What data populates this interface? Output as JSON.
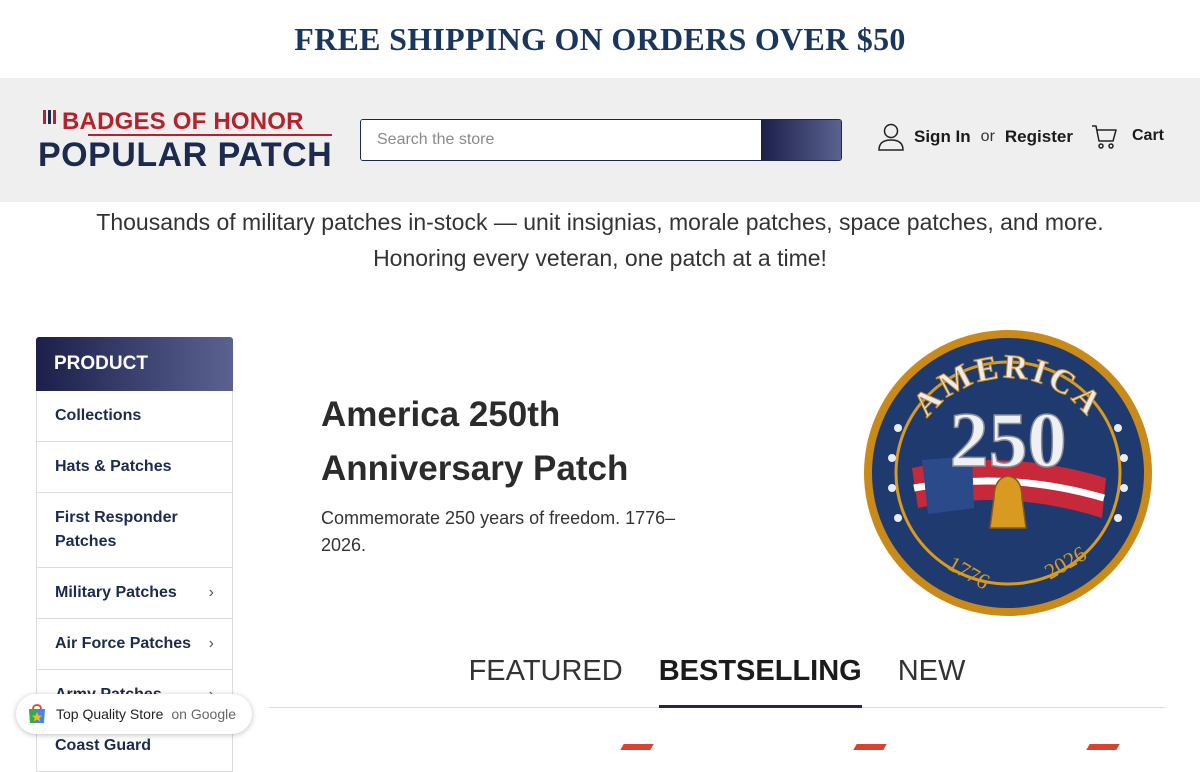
{
  "topbar": {
    "text": "FREE SHIPPING ON ORDERS OVER $50"
  },
  "logo": {
    "line1": "BADGES OF HONOR",
    "line2": "POPULAR PATCH"
  },
  "search": {
    "placeholder": "Search the store"
  },
  "account": {
    "sign_in": "Sign In",
    "or": "or",
    "register": "Register"
  },
  "cart": {
    "label": "Cart"
  },
  "tagline": {
    "line1": "Thousands of military patches in-stock — unit insignias, morale patches, space patches, and more.",
    "line2": "Honoring every veteran, one patch at a time!"
  },
  "sidebar": {
    "heading": "PRODUCT",
    "items": [
      {
        "label": "Collections",
        "has_children": false
      },
      {
        "label": "Hats & Patches",
        "has_children": false
      },
      {
        "label": "First Responder Patches",
        "has_children": false
      },
      {
        "label": "Military Patches",
        "has_children": true
      },
      {
        "label": "Air Force Patches",
        "has_children": true
      },
      {
        "label": "Army Patches",
        "has_children": true
      },
      {
        "label": "Coast Guard",
        "has_children": false
      }
    ]
  },
  "hero": {
    "title": "America 250th Anniversary Patch",
    "description": "Commemorate 250 years of freedom. 1776–2026.",
    "patch": {
      "top_text": "AMERICA",
      "number": "250",
      "year_left": "1776",
      "year_right": "2026"
    }
  },
  "tabs": [
    {
      "label": "FEATURED",
      "active": false
    },
    {
      "label": "BESTSELLING",
      "active": true
    },
    {
      "label": "NEW",
      "active": false
    }
  ],
  "google_badge": {
    "text": "Top Quality Store",
    "suffix": "on Google"
  },
  "colors": {
    "navy": "#1b2a4e",
    "brand_red": "#b5222c",
    "header_bg": "#efefef"
  }
}
